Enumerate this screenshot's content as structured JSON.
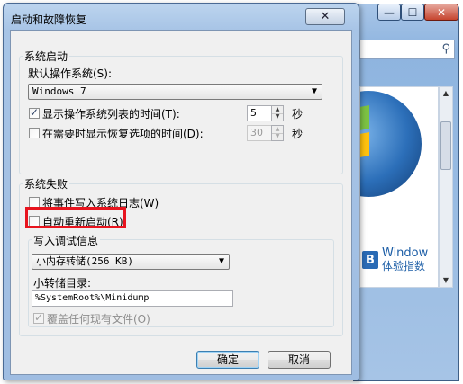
{
  "dialog": {
    "title": "启动和故障恢复",
    "close_glyph": "✕"
  },
  "startup": {
    "group_label": "系统启动",
    "default_os_label": "默认操作系统(S):",
    "default_os_value": "Windows 7",
    "show_os_list_label": "显示操作系统列表的时间(T):",
    "show_os_list_checked": true,
    "show_os_list_value": "5",
    "seconds1": "秒",
    "show_recovery_label": "在需要时显示恢复选项的时间(D):",
    "show_recovery_checked": false,
    "show_recovery_value": "30",
    "seconds2": "秒"
  },
  "failure": {
    "group_label": "系统失败",
    "write_event_label": "将事件写入系统日志(W)",
    "write_event_checked": false,
    "auto_restart_label": "自动重新启动(R)",
    "auto_restart_checked": false,
    "debug_group_label": "写入调试信息",
    "debug_type_value": "小内存转储(256 KB)",
    "dump_dir_label": "小转储目录:",
    "dump_dir_value": "%SystemRoot%\\Minidump",
    "overwrite_label": "覆盖任何现有文件(O)",
    "overwrite_checked": true
  },
  "buttons": {
    "ok": "确定",
    "cancel": "取消"
  },
  "background_window": {
    "min_glyph": "—",
    "max_glyph": "☐",
    "close_glyph": "✕",
    "search_icon": "search-icon",
    "wei_badge": "B",
    "wei_line1": "Window",
    "wei_line2": "体验指数"
  },
  "colors": {
    "highlight_box": "#e8141e"
  }
}
